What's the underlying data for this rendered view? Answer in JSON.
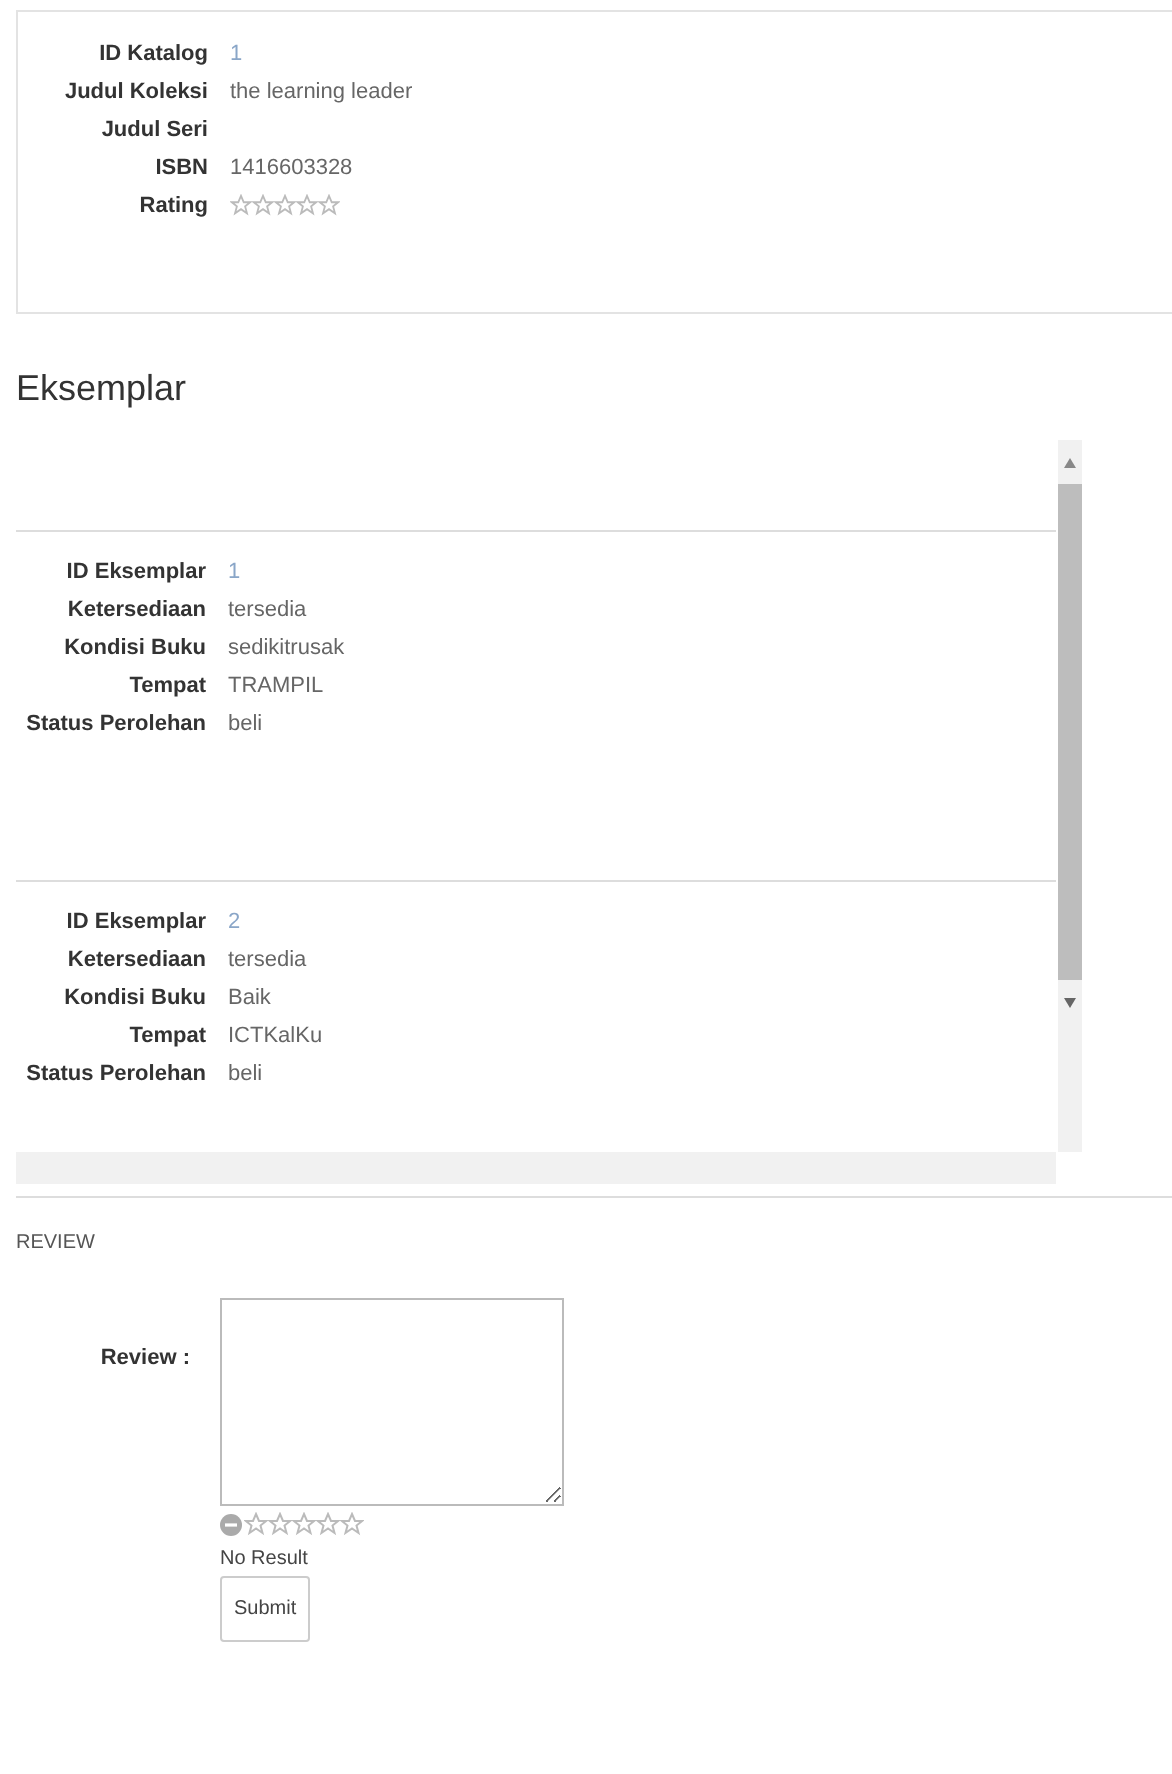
{
  "catalog": {
    "fields": [
      {
        "label": "ID Katalog",
        "value": "1",
        "kind": "link"
      },
      {
        "label": "Judul Koleksi",
        "value": "the learning leader",
        "kind": "text"
      },
      {
        "label": "Judul Seri",
        "kind": "text"
      },
      {
        "label": "ISBN",
        "value": "1416603328",
        "kind": "text"
      },
      {
        "label": "Rating",
        "stars": 0,
        "kind": "stars"
      }
    ]
  },
  "eksemplar": {
    "title": "Eksemplar",
    "items": [
      {
        "fields": [
          {
            "label": "ID Eksemplar",
            "value": "1",
            "kind": "link"
          },
          {
            "label": "Ketersediaan",
            "value": "tersedia",
            "kind": "text"
          },
          {
            "label": "Kondisi Buku",
            "value": "sedikitrusak",
            "kind": "text"
          },
          {
            "label": "Tempat",
            "value": "TRAMPIL",
            "kind": "text"
          },
          {
            "label": "Status Perolehan",
            "value": "beli",
            "kind": "text"
          }
        ]
      },
      {
        "fields": [
          {
            "label": "ID Eksemplar",
            "value": "2",
            "kind": "link"
          },
          {
            "label": "Ketersediaan",
            "value": "tersedia",
            "kind": "text"
          },
          {
            "label": "Kondisi Buku",
            "value": "Baik",
            "kind": "text"
          },
          {
            "label": "Tempat",
            "value": "ICTKalKu",
            "kind": "text"
          },
          {
            "label": "Status Perolehan",
            "value": "beli",
            "kind": "text"
          }
        ]
      }
    ]
  },
  "review": {
    "heading": "REVIEW",
    "label": "Review :",
    "stars": 0,
    "result": "No Result",
    "submit": "Submit"
  }
}
